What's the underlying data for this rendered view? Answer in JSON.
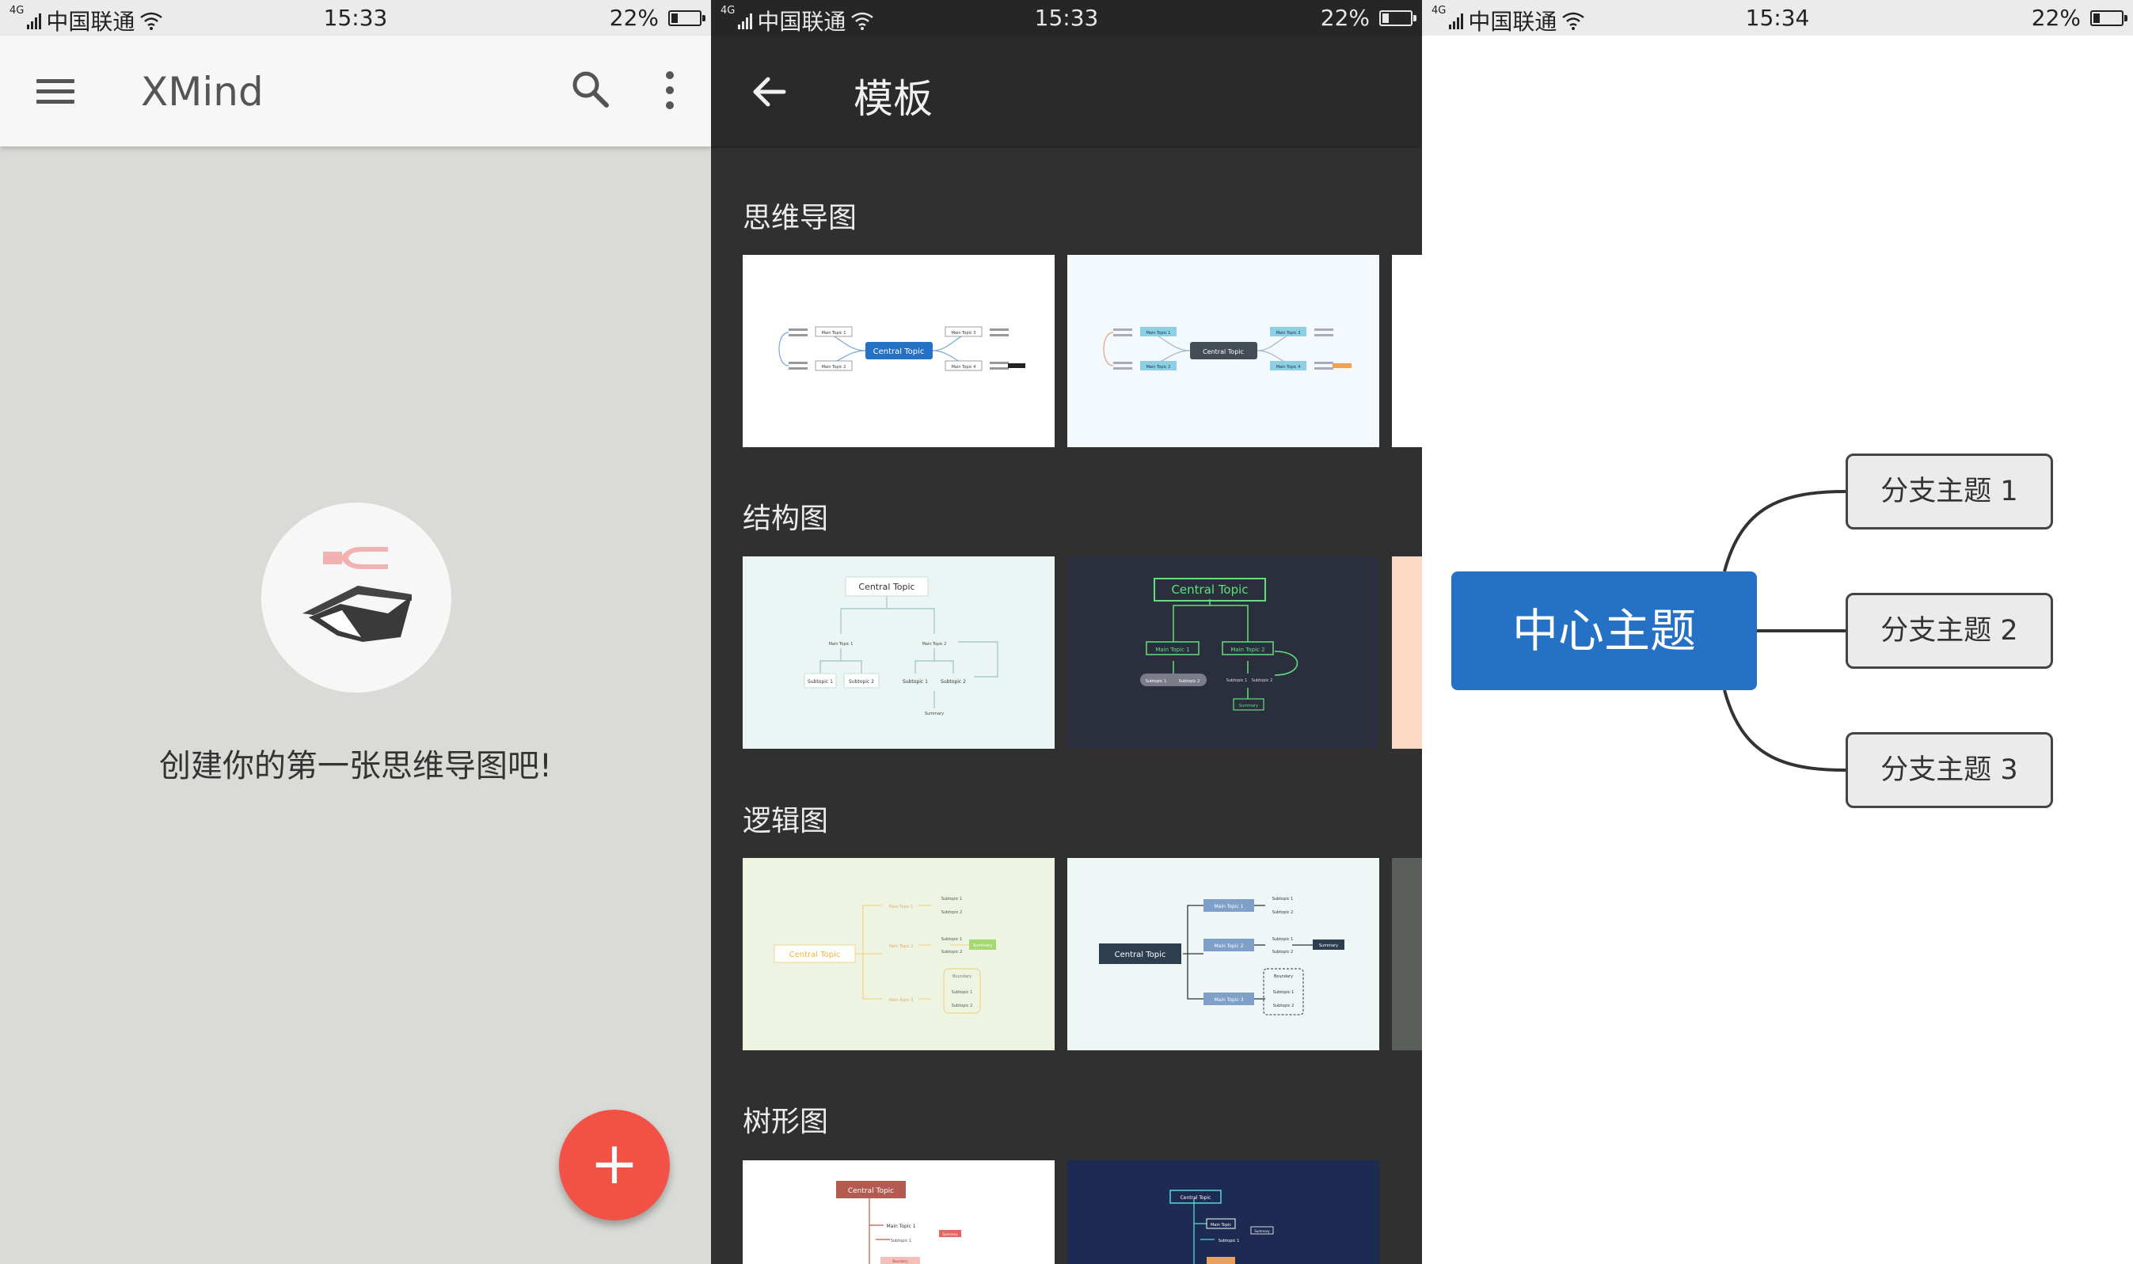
{
  "status_bars": [
    {
      "network": "4G",
      "carrier": "中国联通",
      "time": "15:33",
      "battery": "22%"
    },
    {
      "network": "4G",
      "carrier": "中国联通",
      "time": "15:33",
      "battery": "22%"
    },
    {
      "network": "4G",
      "carrier": "中国联通",
      "time": "15:34",
      "battery": "22%"
    }
  ],
  "home": {
    "app_title": "XMind",
    "empty_message": "创建你的第一张思维导图吧!",
    "fab_label": "+",
    "accent_color": "#f25245"
  },
  "templates": {
    "title": "模板",
    "sections": [
      {
        "title": "思维导图",
        "cards": [
          {
            "central": "Central Topic",
            "mains": [
              "Main Topic 1",
              "Main Topic 2",
              "Main Topic 3",
              "Main Topic 4"
            ]
          },
          {
            "central": "Central Topic",
            "mains": [
              "Main Topic 1",
              "Main Topic 2",
              "Main Topic 3",
              "Main Topic 4"
            ]
          }
        ]
      },
      {
        "title": "结构图",
        "cards": [
          {
            "central": "Central Topic",
            "mains": [
              "Main Topic 1",
              "Main Topic 2"
            ],
            "subs": [
              "Subtopic 1",
              "Subtopic 2",
              "Subtopic 1",
              "Subtopic 2"
            ],
            "summary": "Summary"
          },
          {
            "central": "Central Topic",
            "mains": [
              "Main Topic 1",
              "Main Topic 2"
            ],
            "subs": [
              "Subtopic 1",
              "Subtopic 2",
              "Subtopic 1",
              "Subtopic 2"
            ],
            "summary": "Summary"
          }
        ]
      },
      {
        "title": "逻辑图",
        "cards": [
          {
            "central": "Central Topic",
            "mains": [
              "Main Topic 1",
              "Main Topic 2",
              "Main Topic 3"
            ],
            "subs": [
              "Subtopic 1",
              "Subtopic 2",
              "Subtopic 1",
              "Subtopic 2",
              "Subtopic 1",
              "Subtopic 2"
            ],
            "summary": "Summary",
            "boundary": "Boundary"
          },
          {
            "central": "Central Topic",
            "mains": [
              "Main Topic 1",
              "Main Topic 2",
              "Main Topic 3"
            ],
            "subs": [
              "Subtopic 1",
              "Subtopic 2",
              "Subtopic 1",
              "Subtopic 2",
              "Subtopic 1",
              "Subtopic 2"
            ],
            "summary": "Summary",
            "boundary": "Boundary"
          }
        ]
      },
      {
        "title": "树形图",
        "cards": [
          {
            "central": "Central Topic",
            "mains": [
              "Main Topic 1"
            ],
            "subs": [
              "Subtopic 1"
            ],
            "summary": "Summary",
            "boundary": "Boundary"
          },
          {
            "central": "Central Topic",
            "mains": [
              "Main Topic"
            ],
            "subs": [
              "Subtopic 1"
            ],
            "summary": "Summary"
          }
        ]
      }
    ]
  },
  "mindmap": {
    "central_topic": "中心主题",
    "branches": [
      "分支主题 1",
      "分支主题 2",
      "分支主题 3"
    ],
    "central_color": "#2571c6"
  }
}
